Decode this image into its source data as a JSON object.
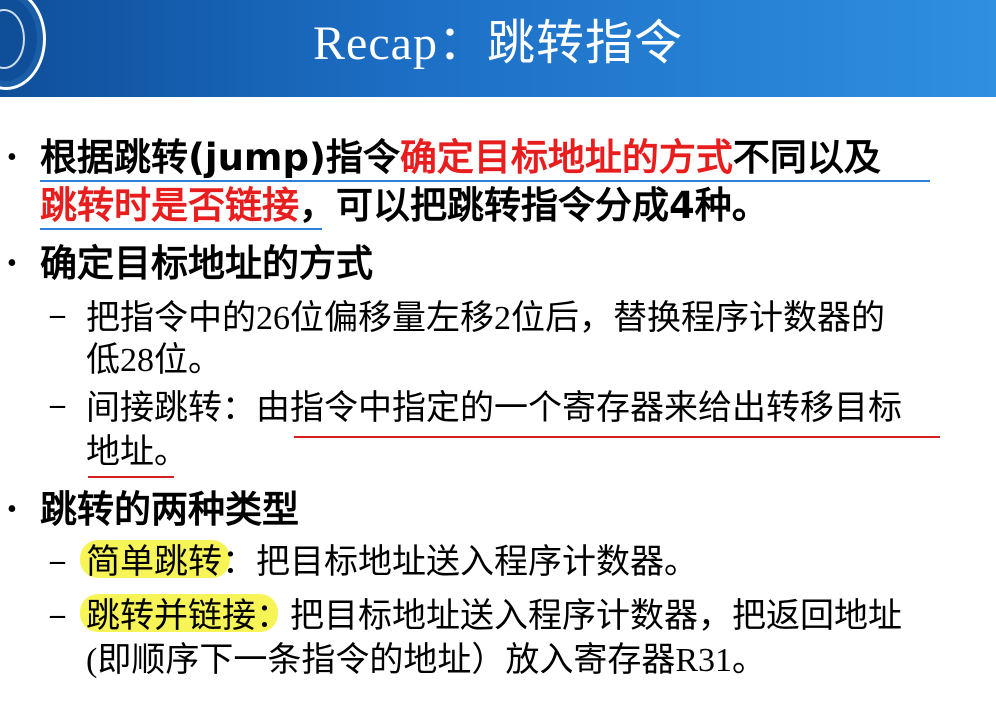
{
  "title": "Recap：跳转指令",
  "bullets": {
    "b1_line1_a": "根据跳转(jump)指令",
    "b1_line1_red": "确定目标地址的方式",
    "b1_line1_b": "不同以及",
    "b1_line2_red": "跳转时是否链接",
    "b1_line2_b": "，可以把跳转指令分成4种。",
    "b2": "确定目标地址的方式",
    "b2_sub1_line1": "把指令中的26位偏移量左移2位后，替换程序计数器的",
    "b2_sub1_line2": "低28位。",
    "b2_sub2_line1": "间接跳转：由指令中指定的一个寄存器来给出转移目标",
    "b2_sub2_line2": "地址。",
    "b3": "跳转的两种类型",
    "b3_sub1": "简单跳转：把目标地址送入程序计数器。",
    "b3_sub2_line1": "跳转并链接：把目标地址送入程序计数器，把返回地址",
    "b3_sub2_line2": "(即顺序下一条指令的地址）放入寄存器R31。"
  },
  "colors": {
    "header": "#1c6ec4",
    "emphasis": "#e81e1e",
    "highlight": "#f6f23a"
  }
}
